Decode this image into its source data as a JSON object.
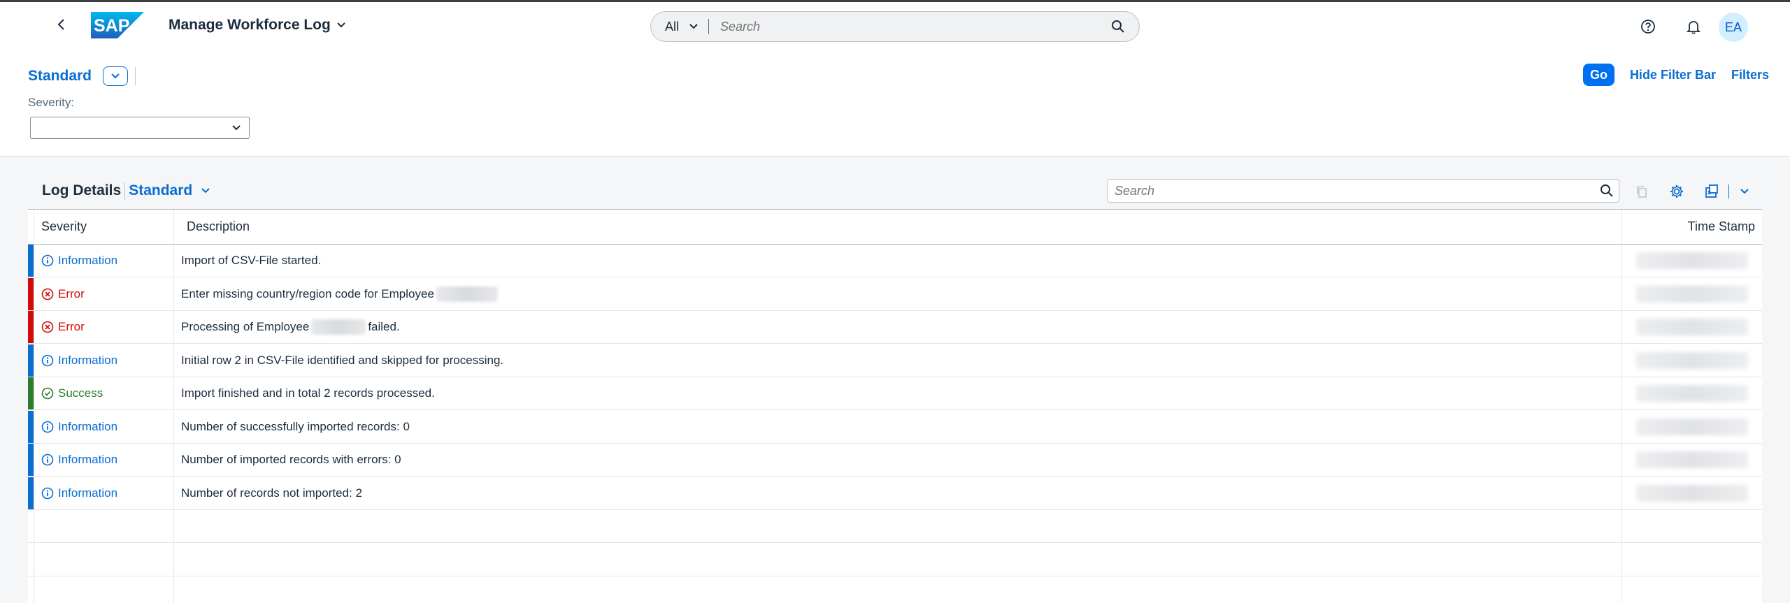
{
  "shell": {
    "app_title": "Manage Workforce Log",
    "logo_text": "SAP",
    "search": {
      "scope": "All",
      "placeholder": "Search"
    },
    "avatar_initials": "EA"
  },
  "filter_bar": {
    "variant_name": "Standard",
    "severity_label": "Severity:",
    "severity_value": "",
    "go_label": "Go",
    "hide_filter_bar_label": "Hide Filter Bar",
    "filters_label": "Filters"
  },
  "table": {
    "title": "Log Details",
    "variant": "Standard",
    "search_placeholder": "Search",
    "columns": {
      "severity": "Severity",
      "description": "Description",
      "timestamp": "Time Stamp"
    },
    "rows": [
      {
        "severity": "Information",
        "icon": "info-icon",
        "color": "#0a6ed1",
        "description": "Import of CSV-File started."
      },
      {
        "severity": "Error",
        "icon": "error-icon",
        "color": "#d20a0a",
        "description": "Enter missing country/region code for Employee"
      },
      {
        "severity": "Error",
        "icon": "error-icon",
        "color": "#d20a0a",
        "description": "Processing of Employee",
        "description_suffix": "failed."
      },
      {
        "severity": "Information",
        "icon": "info-icon",
        "color": "#0a6ed1",
        "description": "Initial row 2 in CSV-File identified and skipped for processing."
      },
      {
        "severity": "Success",
        "icon": "success-icon",
        "color": "#2b7c2b",
        "description": "Import finished and in total 2 records processed."
      },
      {
        "severity": "Information",
        "icon": "info-icon",
        "color": "#0a6ed1",
        "description": "Number of successfully imported records: 0"
      },
      {
        "severity": "Information",
        "icon": "info-icon",
        "color": "#0a6ed1",
        "description": "Number of imported records with errors: 0"
      },
      {
        "severity": "Information",
        "icon": "info-icon",
        "color": "#0a6ed1",
        "description": "Number of records not imported: 2"
      }
    ]
  },
  "colors": {
    "accent": "#0a6ed1",
    "error": "#d20a0a",
    "success": "#2b7c2b",
    "info": "#0a6ed1"
  }
}
